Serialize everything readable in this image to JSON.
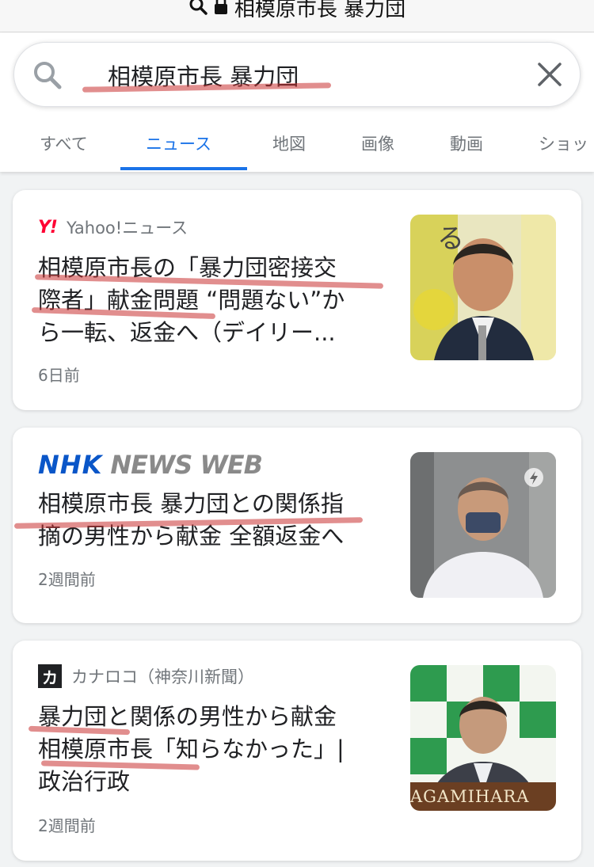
{
  "browser": {
    "url_text": "相模原市長 暴力団"
  },
  "search": {
    "query": "相模原市長 暴力団"
  },
  "tabs": [
    {
      "label": "すべて"
    },
    {
      "label": "ニュース"
    },
    {
      "label": "地図"
    },
    {
      "label": "画像"
    },
    {
      "label": "動画"
    },
    {
      "label": "ショッ"
    }
  ],
  "results": [
    {
      "source": "Yahoo!ニュース",
      "logo_text": "Y!",
      "title_lines": [
        "相模原市長の「暴力団密接交",
        "際者」献金問題 “問題ない”か",
        "ら一転、返金へ（デイリー..."
      ],
      "time": "6日前"
    },
    {
      "source_logo_1": "NHK",
      "source_logo_2": "NEWS WEB",
      "title_lines": [
        "相模原市長 暴力団との関係指",
        "摘の男性から献金 全額返金へ"
      ],
      "time": "2週間前"
    },
    {
      "source": "カナロコ（神奈川新聞）",
      "logo_text": "カ",
      "title_lines": [
        "暴力団と関係の男性から献金",
        "相模原市長「知らなかった」|",
        "政治行政"
      ],
      "time": "2週間前",
      "thumb_caption": "AGAMIHARA"
    }
  ],
  "colors": {
    "accent": "#1a73e8",
    "highlight": "#c83232",
    "yahoo": "#ff0033",
    "nhk": "#0a56c8"
  }
}
